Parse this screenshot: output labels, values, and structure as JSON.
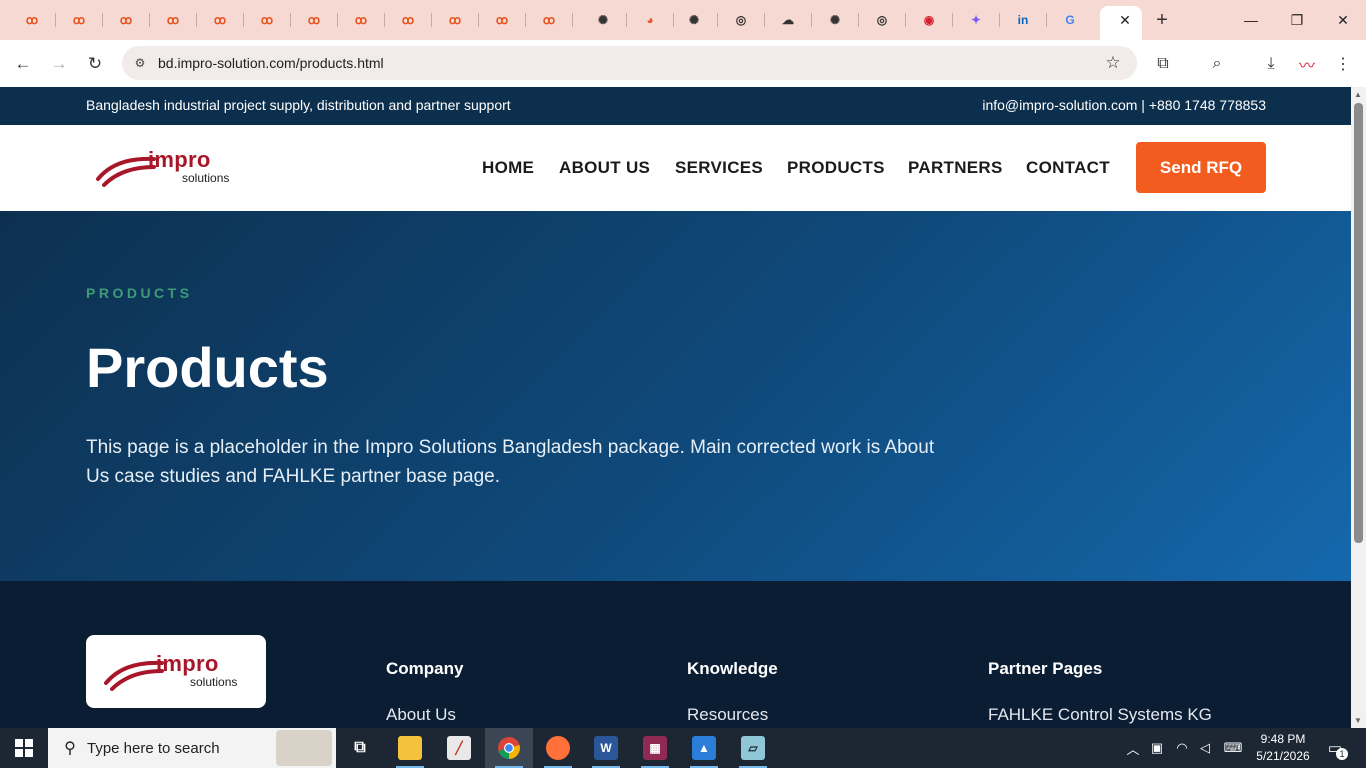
{
  "browser": {
    "tabs": [
      {
        "icon": "copilot-tab-icon",
        "color": "#e8541e"
      },
      {
        "icon": "copilot-tab-icon",
        "color": "#e8541e"
      },
      {
        "icon": "copilot-tab-icon",
        "color": "#e8541e"
      },
      {
        "icon": "copilot-tab-icon",
        "color": "#e8541e"
      },
      {
        "icon": "copilot-tab-icon",
        "color": "#e8541e"
      },
      {
        "icon": "copilot-tab-icon",
        "color": "#e8541e"
      },
      {
        "icon": "copilot-tab-icon",
        "color": "#e8541e"
      },
      {
        "icon": "copilot-tab-icon",
        "color": "#e8541e"
      },
      {
        "icon": "copilot-tab-icon",
        "color": "#e8541e"
      },
      {
        "icon": "copilot-tab-icon",
        "color": "#e8541e"
      },
      {
        "icon": "copilot-tab-icon",
        "color": "#e8541e"
      },
      {
        "icon": "copilot-tab-icon",
        "color": "#e8541e"
      },
      {
        "icon": "chatgpt-tab-icon",
        "color": "#333333"
      },
      {
        "icon": "claude-tab-icon",
        "color": "#e8541e"
      },
      {
        "icon": "chatgpt-tab-icon",
        "color": "#333333"
      },
      {
        "icon": "chrome-tab-icon",
        "color": "#333333"
      },
      {
        "icon": "cloud-tab-icon",
        "color": "#333333"
      },
      {
        "icon": "chatgpt-tab-icon",
        "color": "#333333"
      },
      {
        "icon": "chrome-tab-icon",
        "color": "#333333"
      },
      {
        "icon": "red-swoosh-tab-icon",
        "color": "#d4202c"
      },
      {
        "icon": "gemini-tab-icon",
        "color": "#7a5af8"
      },
      {
        "icon": "linkedin-tab-icon",
        "color": "#0a66c2"
      },
      {
        "icon": "google-tab-icon",
        "color": "#4285f4"
      }
    ],
    "url": "bd.impro-solution.com/products.html"
  },
  "site": {
    "topbar_left": "Bangladesh industrial project supply, distribution and partner support",
    "topbar_right": "info@impro-solution.com | +880 1748 778853",
    "logo_word": "impro",
    "logo_sub": "solutions",
    "nav": [
      "HOME",
      "ABOUT US",
      "SERVICES",
      "PRODUCTS",
      "PARTNERS",
      "CONTACT"
    ],
    "cta": "Send RFQ",
    "hero": {
      "eyebrow": "PRODUCTS",
      "title": "Products",
      "body": "This page is a placeholder in the Impro Solutions Bangladesh package. Main corrected work is About Us case studies and FAHLKE partner base page."
    },
    "footer": {
      "columns": [
        {
          "title": "Company",
          "link": "About Us"
        },
        {
          "title": "Knowledge",
          "link": "Resources"
        },
        {
          "title": "Partner Pages",
          "link": "FAHLKE Control Systems KG"
        }
      ]
    }
  },
  "taskbar": {
    "search_placeholder": "Type here to search",
    "time": "9:48 PM",
    "date": "5/21/2026",
    "notification_count": "1"
  },
  "colors": {
    "topbar": "#0d2f4e",
    "brand_red": "#a8162a",
    "cta": "#f25c1e",
    "eyebrow": "#3d9c76",
    "footer": "#0a1d33"
  }
}
